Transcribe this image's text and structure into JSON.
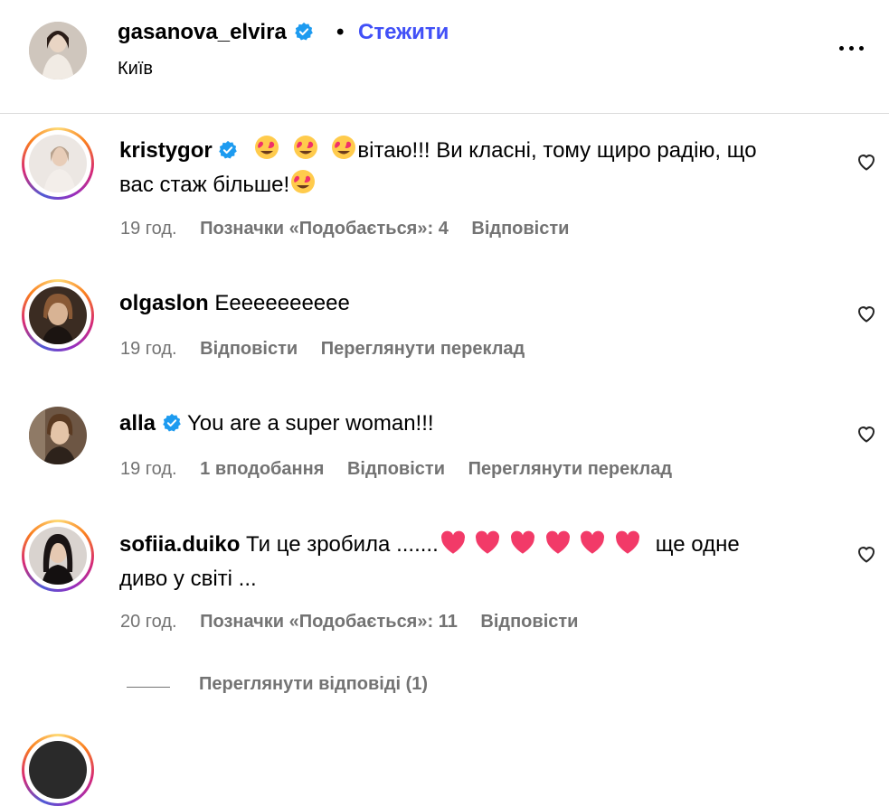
{
  "header": {
    "username": "gasanova_elvira",
    "separator": "•",
    "follow_label": "Стежити",
    "location": "Київ"
  },
  "comments": [
    {
      "username": "kristygor",
      "verified": true,
      "text_line1": "вітаю!!! Ви класні, тому щиро радію, що",
      "text_line2": "вас стаж більше!",
      "time": "19 год.",
      "likes": "Позначки «Подобається»: 4",
      "reply": "Відповісти"
    },
    {
      "username": "olgaslon",
      "verified": false,
      "text": "Еееееееееее",
      "time": "19 год.",
      "reply": "Відповісти",
      "translate": "Переглянути переклад"
    },
    {
      "username": "alla",
      "verified": true,
      "text": "You are a super woman!!!",
      "time": "19 год.",
      "likes": "1 вподобання",
      "reply": "Відповісти",
      "translate": "Переглянути переклад"
    },
    {
      "username": "sofiia.duiko",
      "verified": false,
      "text_line1_a": "Ти це зробила .......",
      "text_line1_b": "ще одне",
      "text_line2": "диво у світі ...",
      "time": "20 год.",
      "likes": "Позначки «Подобається»: 11",
      "reply": "Відповісти",
      "view_replies": "Переглянути відповіді (1)"
    }
  ],
  "colors": {
    "accent": "#4150f7",
    "muted": "#737373",
    "verified": "#1d9bf0",
    "border": "#dbdbdb"
  },
  "icons": [
    "verified-badge-icon",
    "more-options-icon",
    "heart-outline-icon",
    "heart-eyes-emoji",
    "red-heart-emoji"
  ]
}
